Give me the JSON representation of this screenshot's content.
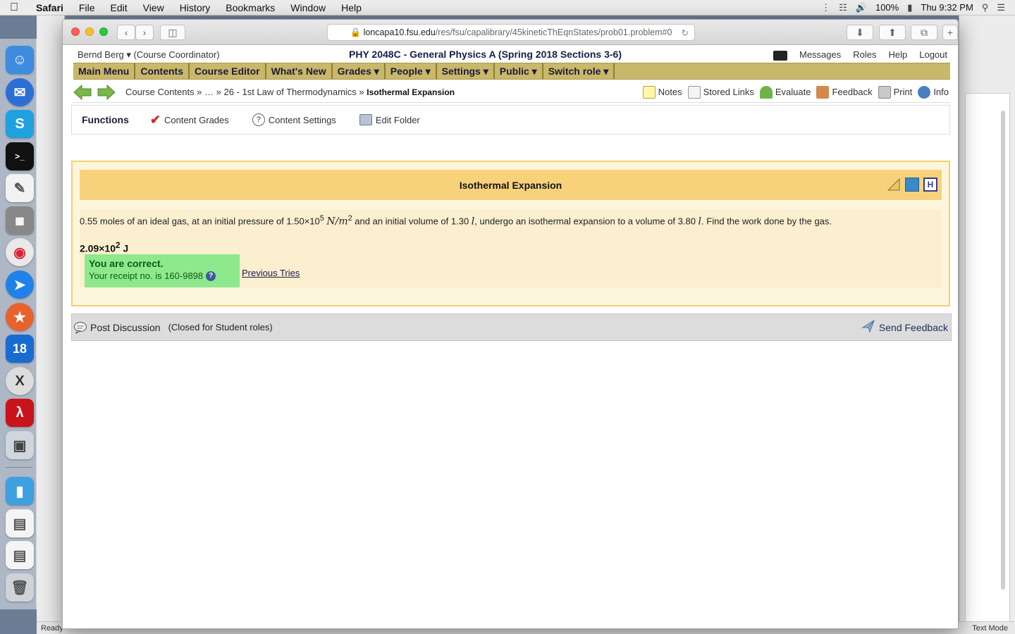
{
  "menubar": {
    "app": "Safari",
    "items": [
      "File",
      "Edit",
      "View",
      "History",
      "Bookmarks",
      "Window",
      "Help"
    ],
    "battery": "100%",
    "clock": "Thu 9:32 PM"
  },
  "browser": {
    "url_host": "loncapa10.fsu.edu",
    "url_path": "/res/fsu/capalibrary/45kineticThEqnStates/prob01.problem#0"
  },
  "header": {
    "user": "Bernd Berg ▾",
    "role": "(Course Coordinator)",
    "course_title": "PHY 2048C - General Physics A (Spring 2018 Sections 3-6)",
    "links": [
      "Messages",
      "Roles",
      "Help",
      "Logout"
    ]
  },
  "main_menu": [
    "Main Menu",
    "Contents",
    "Course Editor",
    "What's New",
    "Grades ▾",
    "People ▾",
    "Settings ▾",
    "Public ▾",
    "Switch role ▾"
  ],
  "breadcrumb": {
    "part1": "Course Contents » … » 26 - 1st Law of Thermodynamics »",
    "current": "Isothermal Expansion"
  },
  "tools": {
    "notes": "Notes",
    "stored_links": "Stored Links",
    "evaluate": "Evaluate",
    "feedback": "Feedback",
    "print": "Print",
    "info": "Info"
  },
  "functions": {
    "heading": "Functions",
    "content_grades": "Content Grades",
    "content_settings": "Content Settings",
    "edit_folder": "Edit Folder"
  },
  "problem": {
    "title": "Isothermal Expansion",
    "q_part1": "0.55 moles of an ideal gas, at an initial pressure of 1.50×10",
    "q_exp1": "5",
    "q_unit1": "N/m",
    "q_exp2": "2",
    "q_part2": " and an initial volume of 1.30 ",
    "q_unit2": "l",
    "q_part3": ", undergo an isothermal expansion to a volume of 3.80 ",
    "q_unit3": "l",
    "q_part4": ". Find the work done by the gas.",
    "answer_base": "2.09×10",
    "answer_exp": "2",
    "answer_unit": " J",
    "correct_msg": "You are correct.",
    "receipt": "Your receipt no. is 160-9898",
    "previous_tries": "Previous Tries"
  },
  "discussion": {
    "post": "Post Discussion",
    "closed": "(Closed for Student roles)",
    "send_feedback": "Send Feedback"
  },
  "statusbar": {
    "left": "Ready",
    "right": "Text Mode"
  },
  "colors": {
    "main_menu_bg": "#c9b86a",
    "problem_border": "#f3cf72",
    "problem_header": "#f8d27a",
    "correct_bg": "#8ee88c"
  }
}
